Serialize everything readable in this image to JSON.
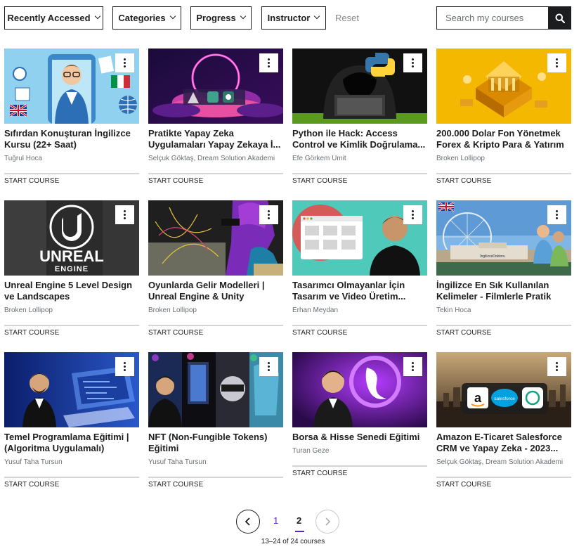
{
  "filters": {
    "recently_accessed": "Recently Accessed",
    "categories": "Categories",
    "progress": "Progress",
    "instructor": "Instructor",
    "reset": "Reset"
  },
  "search": {
    "placeholder": "Search my courses"
  },
  "courses": [
    {
      "title": "Sıfırdan Konuşturan İngilizce Kursu (22+ Saat)",
      "instructor": "Tuğrul Hoca",
      "action": "START COURSE"
    },
    {
      "title": "Pratikte Yapay Zeka Uygulamaları Yapay Zekaya İ...",
      "instructor": "Selçuk Göktaş, Dream Solution Akademi",
      "action": "START COURSE"
    },
    {
      "title": "Python ile Hack: Access Control ve Kimlik Doğrulama...",
      "instructor": "Efe Görkem Ümit",
      "action": "START COURSE"
    },
    {
      "title": "200.000 Dolar Fon Yönetmek Forex & Kripto Para & Yatırım",
      "instructor": "Broken Lollipop",
      "action": "START COURSE"
    },
    {
      "title": "Unreal Engine 5 Level Design ve Landscapes",
      "instructor": "Broken Lollipop",
      "action": "START COURSE"
    },
    {
      "title": "Oyunlarda Gelir Modelleri | Unreal Engine & Unity",
      "instructor": "Broken Lollipop",
      "action": "START COURSE"
    },
    {
      "title": "Tasarımcı Olmayanlar İçin Tasarım ve Video Üretim...",
      "instructor": "Erhan Meydan",
      "action": "START COURSE"
    },
    {
      "title": "İngilizce En Sık Kullanılan Kelimeler - Filmlerle Pratik",
      "instructor": "Tekin Hoca",
      "action": "START COURSE"
    },
    {
      "title": "Temel Programlama Eğitimi | (Algoritma Uygulamalı)",
      "instructor": "Yusuf Taha Tursun",
      "action": "START COURSE"
    },
    {
      "title": "NFT (Non-Fungible Tokens) Eğitimi",
      "instructor": "Yusuf Taha Tursun",
      "action": "START COURSE"
    },
    {
      "title": "Borsa & Hisse Senedi Eğitimi",
      "instructor": "Turan Geze",
      "action": "START COURSE"
    },
    {
      "title": "Amazon E-Ticaret Salesforce CRM ve Yapay Zeka - 2023...",
      "instructor": "Selçuk Göktaş, Dream Solution Akademi",
      "action": "START COURSE"
    }
  ],
  "thumb_text": {
    "unreal_line1": "UNREAL",
    "unreal_line2": "ENGINE",
    "ing_logo": "İngilizceDoktoru",
    "salesforce": "salesforce"
  },
  "pagination": {
    "pages": [
      "1",
      "2"
    ],
    "current": "2",
    "summary": "13–24 of 24 courses"
  },
  "colors": {
    "text": "#1c1d1f",
    "muted": "#6a6f73",
    "accent": "#5624d0",
    "border": "#d1d7dc"
  },
  "icons": {
    "search": "search-icon",
    "menu": "kebab-menu-icon",
    "prev": "chevron-left-icon",
    "next": "chevron-right-icon",
    "dropdown": "chevron-down-icon"
  }
}
